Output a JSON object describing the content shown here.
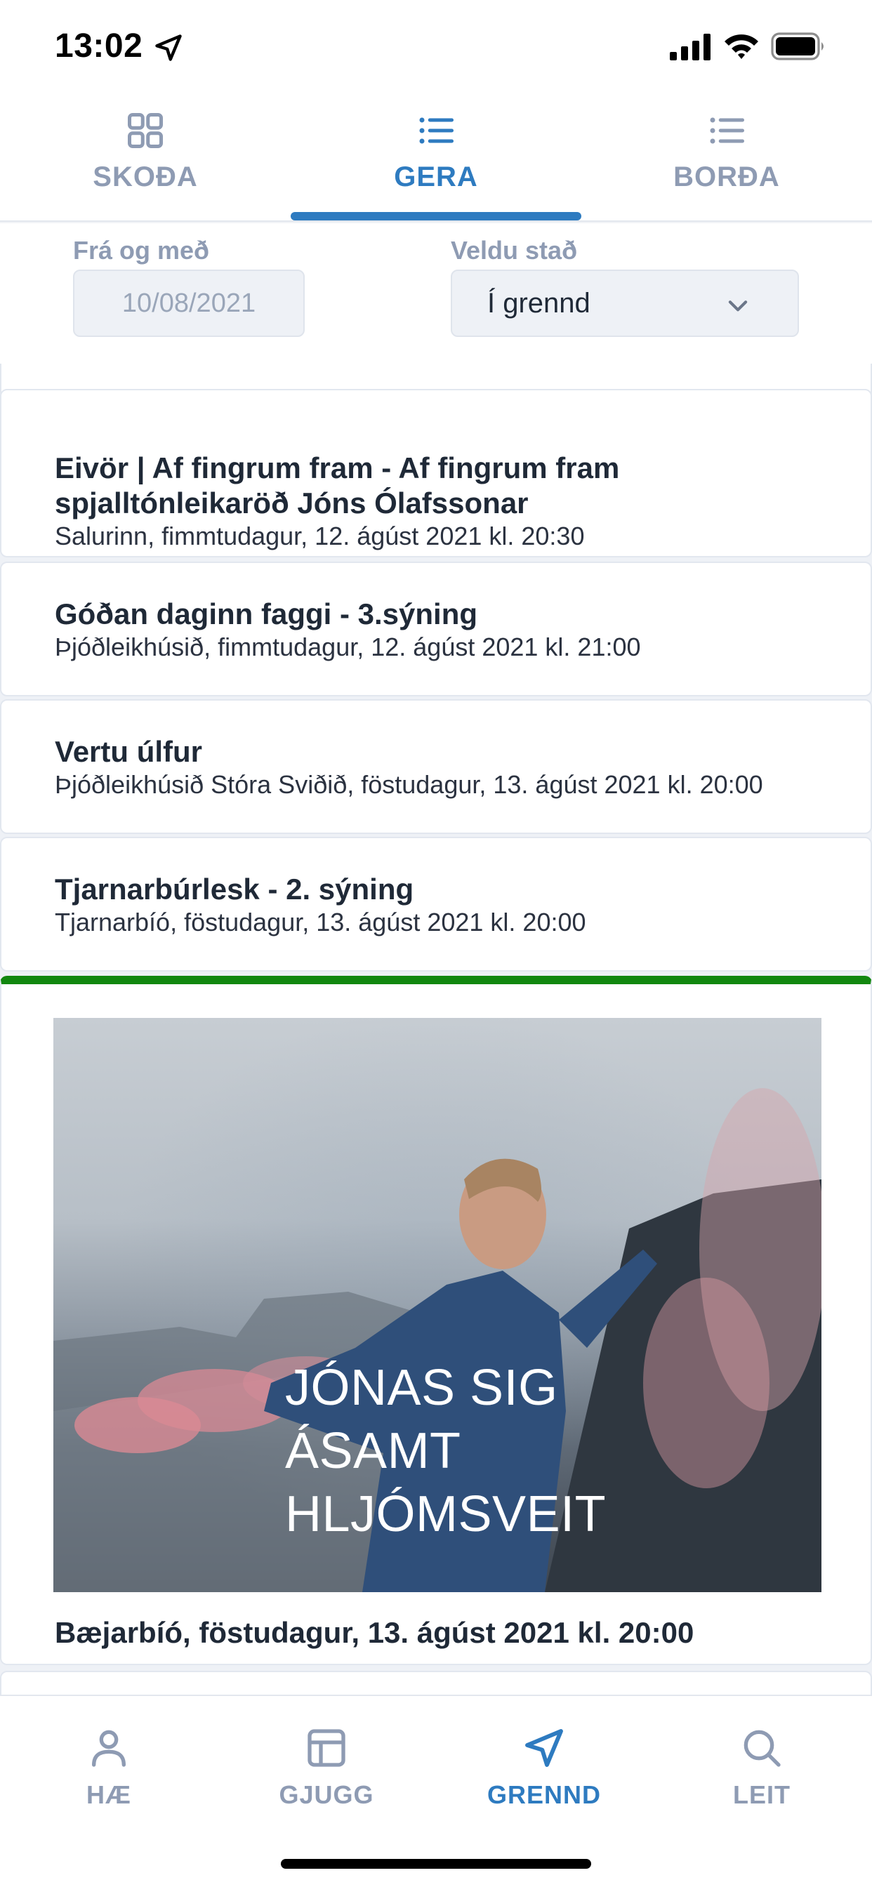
{
  "status_bar": {
    "time": "13:02",
    "icons": [
      "location-arrow-icon",
      "cellular-signal-icon",
      "wifi-icon",
      "battery-icon"
    ]
  },
  "top_tabs": [
    {
      "label": "SKOÐA",
      "icon": "grid-icon",
      "active": false
    },
    {
      "label": "GERA",
      "icon": "list-icon",
      "active": true
    },
    {
      "label": "BORÐA",
      "icon": "list-icon",
      "active": false
    }
  ],
  "filters": {
    "date_label": "Frá og með",
    "date_value": "10/08/2021",
    "location_label": "Veldu stað",
    "location_value": "Í grennd"
  },
  "events": [
    {
      "title": "Eivör | Af fingrum fram - Af fingrum fram spjalltónleikaröð Jóns Ólafssonar",
      "subtitle": "Salurinn, fimmtudagur, 12. ágúst 2021 kl. 20:30"
    },
    {
      "title": "Góðan daginn faggi - 3.sýning",
      "subtitle": "Þjóðleikhúsið, fimmtudagur, 12. ágúst 2021 kl. 21:00"
    },
    {
      "title": "Vertu úlfur",
      "subtitle": "Þjóðleikhúsið Stóra Sviðið, föstudagur, 13. ágúst 2021 kl. 20:00"
    },
    {
      "title": "Tjarnarbúrlesk - 2. sýning",
      "subtitle": "Tjarnarbíó, föstudagur, 13. ágúst 2021 kl. 20:00"
    }
  ],
  "featured": {
    "overlay_title": "JÓNAS SIG ÁSAMT HLJÓMSVEIT",
    "caption": "Bæjarbíó, föstudagur, 13. ágúst 2021 kl. 20:00",
    "accent_color": "#12870f"
  },
  "bottom_nav": [
    {
      "label": "HÆ",
      "icon": "person-icon",
      "active": false
    },
    {
      "label": "GJUGG",
      "icon": "layout-icon",
      "active": false
    },
    {
      "label": "GRENND",
      "icon": "navigation-arrow-icon",
      "active": true
    },
    {
      "label": "LEIT",
      "icon": "search-icon",
      "active": false
    }
  ],
  "colors": {
    "accent": "#2e7bc0",
    "inactive": "#8e9bb3",
    "featured_border": "#12870f"
  }
}
